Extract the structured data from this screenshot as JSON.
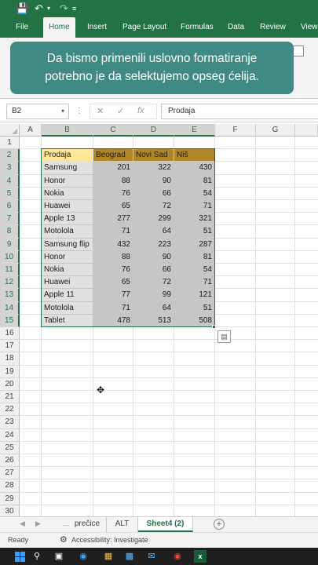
{
  "titlebar": {
    "save_icon": "save-icon",
    "undo_icon": "undo-icon",
    "redo_icon": "redo-icon"
  },
  "ribbon": {
    "tabs": [
      "File",
      "Home",
      "Insert",
      "Page Layout",
      "Formulas",
      "Data",
      "Review",
      "View"
    ],
    "active_tab": "Home"
  },
  "banner": {
    "line1": "Da bismo primenili uslovno formatiranje",
    "line2": "potrebno je da selektujemo opseg ćelija."
  },
  "formula_bar": {
    "name_box": "B2",
    "cancel_glyph": "✕",
    "enter_glyph": "✓",
    "fx_glyph": "fx",
    "content": "Prodaja"
  },
  "grid": {
    "columns": [
      "A",
      "B",
      "C",
      "D",
      "E",
      "F",
      "G"
    ],
    "selected_columns": [
      "B",
      "C",
      "D",
      "E"
    ],
    "rows": [
      1,
      2,
      3,
      4,
      5,
      6,
      7,
      8,
      9,
      10,
      11,
      12,
      13,
      14,
      15,
      16,
      17,
      18,
      19,
      20,
      21,
      22,
      23,
      24,
      25,
      26,
      27,
      28,
      29,
      30
    ],
    "selected_rows": [
      2,
      3,
      4,
      5,
      6,
      7,
      8,
      9,
      10,
      11,
      12,
      13,
      14,
      15
    ]
  },
  "table": {
    "headers": [
      "Prodaja",
      "Beograd",
      "Novi Sad",
      "Niš"
    ],
    "rows": [
      [
        "Samsung",
        "201",
        "322",
        "430"
      ],
      [
        "Honor",
        "88",
        "90",
        "81"
      ],
      [
        "Nokia",
        "76",
        "66",
        "54"
      ],
      [
        "Huawei",
        "65",
        "72",
        "71"
      ],
      [
        "Apple 13",
        "277",
        "299",
        "321"
      ],
      [
        "Motolola",
        "71",
        "64",
        "51"
      ],
      [
        "Samsung flip",
        "432",
        "223",
        "287"
      ],
      [
        "Honor",
        "88",
        "90",
        "81"
      ],
      [
        "Nokia",
        "76",
        "66",
        "54"
      ],
      [
        "Huawei",
        "65",
        "72",
        "71"
      ],
      [
        "Apple 11",
        "77",
        "99",
        "121"
      ],
      [
        "Motolola",
        "71",
        "64",
        "51"
      ],
      [
        "Tablet",
        "478",
        "513",
        "508"
      ]
    ]
  },
  "sheets": {
    "tabs": [
      "prečice",
      "ALT",
      "Sheet4 (2)"
    ],
    "active": "Sheet4 (2)",
    "more": "..."
  },
  "status": {
    "ready": "Ready",
    "accessibility": "Accessibility: Investigate"
  },
  "colors": {
    "excel_green": "#217346",
    "banner_bg": "#3f8a82",
    "header_gold": "#c99a2e",
    "header_first": "#ffe699",
    "data_gray": "#e2e2e2"
  },
  "taskbar": {
    "icons": [
      "windows-start-icon",
      "search-icon",
      "task-view-icon",
      "edge-icon",
      "file-explorer-icon",
      "store-icon",
      "mail-icon",
      "chrome-icon",
      "excel-icon"
    ]
  }
}
